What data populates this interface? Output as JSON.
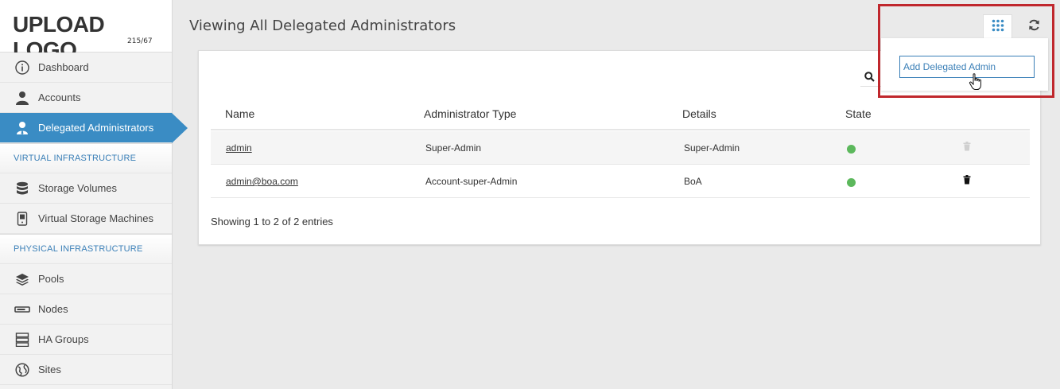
{
  "brand": {
    "logo": "UPLOAD LOGO",
    "logo_sub": "215/67"
  },
  "sidebar": {
    "items": [
      {
        "label": "Dashboard",
        "icon": "info-circle-icon"
      },
      {
        "label": "Accounts",
        "icon": "user-icon"
      },
      {
        "label": "Delegated Administrators",
        "icon": "user-admin-icon",
        "active": true
      }
    ],
    "sections": [
      {
        "title": "VIRTUAL INFRASTRUCTURE",
        "items": [
          {
            "label": "Storage Volumes",
            "icon": "database-icon"
          },
          {
            "label": "Virtual Storage Machines",
            "icon": "server-tower-icon"
          }
        ]
      },
      {
        "title": "PHYSICAL INFRASTRUCTURE",
        "items": [
          {
            "label": "Pools",
            "icon": "layers-icon"
          },
          {
            "label": "Nodes",
            "icon": "node-bar-icon"
          },
          {
            "label": "HA Groups",
            "icon": "server-stack-icon"
          },
          {
            "label": "Sites",
            "icon": "globe-icon"
          }
        ]
      }
    ]
  },
  "header": {
    "title": "Viewing All Delegated Administrators"
  },
  "toolbar": {
    "grid_icon": "grid-icon",
    "refresh_icon": "refresh-icon",
    "menu_item": "Add Delegated Admin"
  },
  "table": {
    "columns": [
      "Name",
      "Administrator Type",
      "Details",
      "State"
    ],
    "rows": [
      {
        "name": "admin",
        "type": "Super-Admin",
        "details": "Super-Admin",
        "state": "active",
        "delete_enabled": false
      },
      {
        "name": "admin@boa.com",
        "type": "Account-super-Admin",
        "details": "BoA",
        "state": "active",
        "delete_enabled": true
      }
    ],
    "footer": "Showing 1 to 2 of 2 entries"
  },
  "colors": {
    "accent": "#3a8cc4",
    "state_active": "#5cb85c",
    "highlight": "#c0272d"
  }
}
